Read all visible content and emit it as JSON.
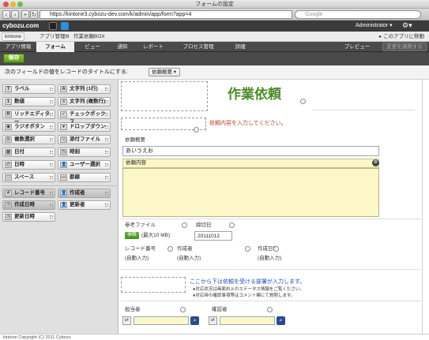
{
  "window": {
    "title": "フォームの設定"
  },
  "browser": {
    "url": "https://kintone3.cybozu-dev.com/k/admin/app/form?app=4",
    "search_placeholder": "Google"
  },
  "header": {
    "logo": "cybozu.com",
    "user": "Administrator"
  },
  "breadcrumb": {
    "home": "kintone",
    "app_admin": "アプリ管理",
    "app_name": "作業依頼BOX",
    "move_link": "このアプリに移動"
  },
  "menu": {
    "items": [
      "アプリ情報",
      "フォーム",
      "ビュー",
      "通知",
      "レポート",
      "プロセス管理",
      "詳細",
      "プレビュー"
    ],
    "apply_button": "変更を適用する"
  },
  "toolbar": {
    "save_label": "保存"
  },
  "title_field": {
    "label": "次のフィールドの値をレコードのタイトルにする:",
    "selected": "依頼概要"
  },
  "palette": {
    "left": [
      "ラベル",
      "数値",
      "リッチエディター",
      "ラジオボタン",
      "複数選択",
      "日付",
      "日時",
      "スペース"
    ],
    "right": [
      "文字列 (1行)",
      "文字列 (複数行)",
      "チェックボックス",
      "ドロップダウン",
      "添付ファイル",
      "時刻",
      "ユーザー選択",
      "罫線"
    ],
    "system_left": [
      "レコード番号",
      "作成日時",
      "更新日時"
    ],
    "system_right": [
      "作成者",
      "更新者"
    ]
  },
  "form": {
    "heading": "作業依頼",
    "instruction_red": "依頼内容を入力してください。",
    "summary_label": "依頼概要",
    "summary_value": "あいうえお",
    "content_label": "依頼内容",
    "attachment_label": "参考ファイル",
    "attach_button": "参照",
    "attach_note": "(最大10 MB)",
    "deadline_label": "締切日",
    "deadline_value": "20111012",
    "record_no_label": "レコード番号",
    "record_no_value": "(自動入力)",
    "creator_label": "作成者",
    "creator_value": "(自動入力)",
    "created_label": "作成日時",
    "created_value": "(自動入力)",
    "info_blue": "ここから下は依頼を受ける部署が入力します。",
    "info_line1": "●対応状況は画面右上のステータス情報をご覧ください。",
    "info_line2": "●対応時の確認事項等はコメント欄にて質問します。",
    "assignee_label": "担当者",
    "confirmer_label": "確認者"
  },
  "footer": {
    "copyright": "kintone Copyright (C) 2011 Cybozu"
  },
  "colors": {
    "heading_green": "#4b8c2b",
    "save_green": "#5e9c1a",
    "highlight_yellow": "#fbf7c8"
  }
}
